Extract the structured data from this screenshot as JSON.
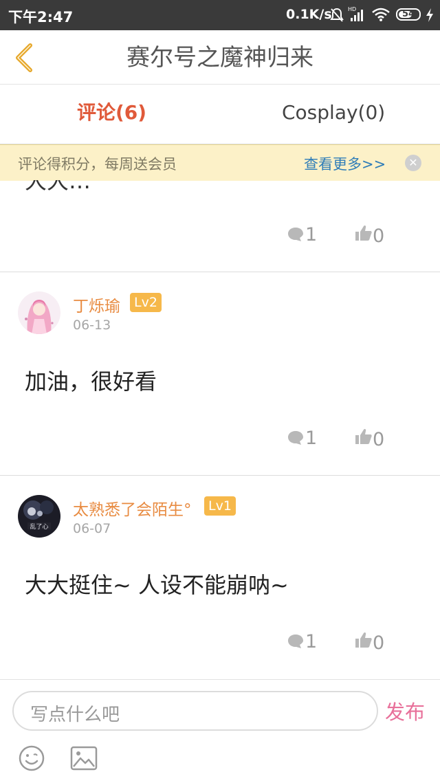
{
  "status_bar": {
    "time": "下午2:47",
    "speed": "0.1K/s",
    "battery": "54",
    "icons": [
      "mute-bell-icon",
      "hd-signal-icon",
      "wifi-icon",
      "battery-icon",
      "charging-icon"
    ]
  },
  "header": {
    "title": "赛尔号之魔神归来",
    "back_icon": "chevron-left-icon",
    "accent": "#e6a72a"
  },
  "tabs": {
    "comments": "评论(6)",
    "cosplay": "Cosplay(0)"
  },
  "banner": {
    "text": "评论得积分，每周送会员",
    "link": "查看更多>>",
    "close_icon": "close-icon"
  },
  "comments": {
    "top_partial": {
      "text_fragment": "大大…",
      "replies": "1",
      "likes": "0"
    },
    "items": [
      {
        "username": "丁烁瑜",
        "level": "Lv2",
        "date": "06-13",
        "text": "加油，很好看",
        "replies": "1",
        "likes": "0"
      },
      {
        "username": "太熟悉了会陌生°",
        "level": "Lv1",
        "date": "06-07",
        "text": "大大挺住~ 人设不能崩呐~",
        "replies": "1",
        "likes": "0"
      }
    ]
  },
  "input_bar": {
    "placeholder": "写点什么吧",
    "publish": "发布",
    "emoji_icon": "emoji-icon",
    "image_icon": "image-icon"
  },
  "colors": {
    "tab_active": "#e05a3a",
    "username": "#e88b41",
    "level_badge": "#f6b84a",
    "publish": "#e8709a",
    "banner_bg": "#fcf1c8",
    "link": "#2f7db8"
  }
}
